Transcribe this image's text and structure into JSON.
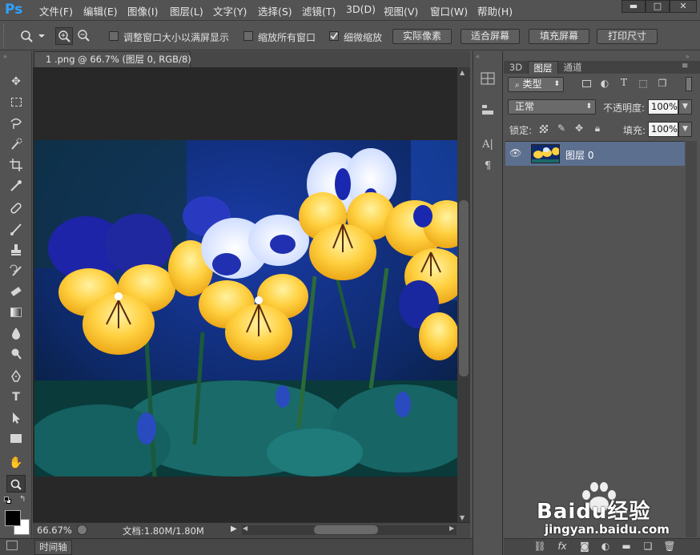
{
  "app": {
    "logo": "Ps"
  },
  "menu": [
    "文件(F)",
    "编辑(E)",
    "图像(I)",
    "图层(L)",
    "文字(Y)",
    "选择(S)",
    "滤镜(T)",
    "3D(D)",
    "视图(V)",
    "窗口(W)",
    "帮助(H)"
  ],
  "window_controls": {
    "minimize": "▬",
    "maximize": "□",
    "close": "✕"
  },
  "options": {
    "resize_windows": "调整窗口大小以满屏显示",
    "zoom_all": "缩放所有窗口",
    "scrubby_zoom": "细微缩放",
    "scrubby_checked": true,
    "buttons": [
      "实际像素",
      "适合屏幕",
      "填充屏幕",
      "打印尺寸"
    ]
  },
  "document": {
    "tab_title": "1 .png @ 66.7% (图层 0, RGB/8)",
    "zoom": "66.67%",
    "doc_size": "文档:1.80M/1.80M"
  },
  "timeline": {
    "label": "时间轴"
  },
  "layers_panel": {
    "tabs": [
      "3D",
      "图层",
      "通道"
    ],
    "active_tab": "图层",
    "filter_kind": "类型",
    "blend_mode": "正常",
    "opacity_label": "不透明度:",
    "opacity_value": "100%",
    "lock_label": "锁定:",
    "fill_label": "填充:",
    "fill_value": "100%",
    "layers": [
      {
        "name": "图层 0",
        "visible": true,
        "selected": true
      }
    ],
    "bottom_icons": [
      "link-icon",
      "fx-icon",
      "mask-icon",
      "adjustment-icon",
      "folder-icon",
      "new-layer-icon",
      "trash-icon"
    ]
  },
  "watermark": {
    "brand": "Baidu经验",
    "url": "jingyan.baidu.com"
  },
  "colors": {
    "accent": "#2fa3ff",
    "selected_layer": "#5c6f8f",
    "ui_bg": "#535353",
    "canvas_bg": "#282828"
  }
}
